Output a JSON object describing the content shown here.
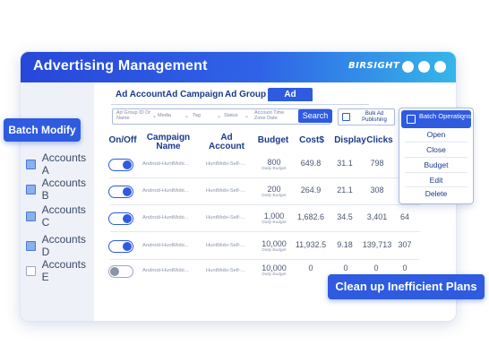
{
  "window": {
    "title": "Advertising Management",
    "logo": "BIRSIGHT"
  },
  "colors": {
    "brand": "#2f5be0",
    "titlebar_start": "#2747d9",
    "titlebar_end": "#36b6e8"
  },
  "tabs": [
    {
      "label": "Ad Account"
    },
    {
      "label": "Ad Campaign"
    },
    {
      "label": "Ad Group"
    },
    {
      "label": "Ad",
      "active": true
    }
  ],
  "filters": {
    "ad_group": "Ad Group ID Or Name",
    "media": "Media",
    "tag": "Tag",
    "status": "Status",
    "time": "Account Time Zone Date",
    "search_label": "Search",
    "bulk_label": "Bulk Ad Publishing"
  },
  "columns": {
    "onoff": "On/Off",
    "campaign": "Campaign Name",
    "adaccount": "Ad Account",
    "budget": "Budget",
    "cost": "Cost$",
    "display": "Display",
    "clicks": "Clicks"
  },
  "sidebar": {
    "batch_modify": "Batch Modify",
    "accounts": [
      {
        "label": "Accounts A",
        "checked": true
      },
      {
        "label": "Accounts B",
        "checked": true
      },
      {
        "label": "Accounts C",
        "checked": true
      },
      {
        "label": "Accounts D",
        "checked": true
      },
      {
        "label": "Accounts E",
        "checked": false
      }
    ]
  },
  "rows": [
    {
      "on": true,
      "campaign": "Android-HuntMobi...",
      "account": "HuntMobi-Self-...",
      "budget": "800",
      "budget_sub": "Daily Budget",
      "cost": "649.8",
      "display": "31.1",
      "clicks": "798"
    },
    {
      "on": true,
      "campaign": "Android-HuntMobi...",
      "account": "HuntMobi-Self-...",
      "budget": "200",
      "budget_sub": "Daily Budget",
      "cost": "264.9",
      "display": "21.1",
      "clicks": "308"
    },
    {
      "on": true,
      "campaign": "Android-HuntMobi...",
      "account": "HuntMobi-Self-...",
      "budget": "1,000",
      "budget_sub": "Daily Budget",
      "cost": "1,682.6",
      "display": "34.5",
      "clicks": "3,401",
      "extra": "64"
    },
    {
      "on": true,
      "campaign": "Android-HuntMobi...",
      "account": "HuntMobi-Self-...",
      "budget": "10,000",
      "budget_sub": "Daily Budget",
      "cost": "11,932.5",
      "display": "9.18",
      "clicks": "139,713",
      "extra": "307"
    },
    {
      "on": false,
      "campaign": "Android-HuntMobi...",
      "account": "HuntMobi-Self-...",
      "budget": "10,000",
      "budget_sub": "Daily Budget",
      "cost": "0",
      "display": "0",
      "clicks": "0",
      "extra": "0"
    }
  ],
  "batch_ops": {
    "label": "Batch Operations",
    "items": [
      "Open",
      "Close",
      "Budget",
      "Edit",
      "Delete"
    ]
  },
  "cleanup_label": "Clean up Inefficient Plans"
}
